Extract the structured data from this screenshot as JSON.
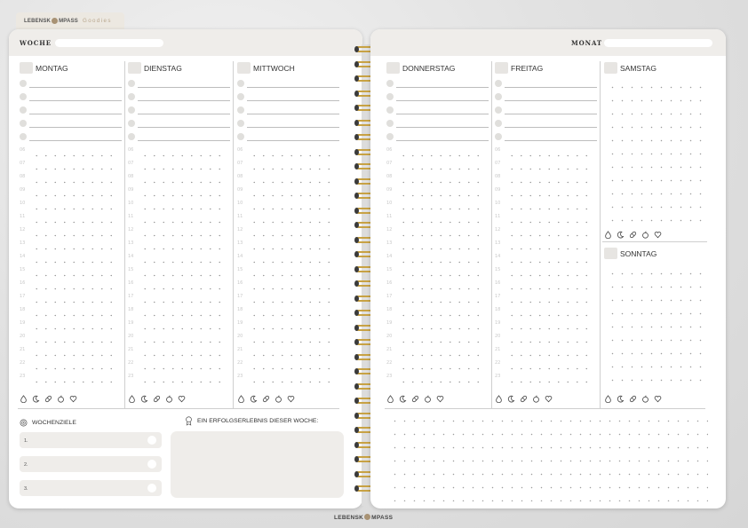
{
  "brand": {
    "part1": "LEBENSK",
    "part2": "MPASS",
    "goodies": "Goodies"
  },
  "left": {
    "week_label": "WOCHE"
  },
  "right": {
    "month_label": "MONAT"
  },
  "days": {
    "mon": "MONTAG",
    "tue": "DIENSTAG",
    "wed": "MITTWOCH",
    "thu": "DONNERSTAG",
    "fri": "FREITAG",
    "sat": "SAMSTAG",
    "sun": "SONNTAG"
  },
  "hours": [
    "06",
    "07",
    "08",
    "09",
    "10",
    "11",
    "12",
    "13",
    "14",
    "15",
    "16",
    "17",
    "18",
    "19",
    "20",
    "21",
    "22",
    "23"
  ],
  "tracker_icons": [
    "water-drop-icon",
    "moon-icon",
    "pill-icon",
    "apple-icon",
    "heart-icon"
  ],
  "goals": {
    "title": "WOCHENZIELE",
    "items": [
      "1.",
      "2.",
      "3."
    ]
  },
  "success": {
    "title": "EIN ERFOLGSERLEBNIS DIESER WOCHE:"
  },
  "footer": {
    "part1": "LEBENSK",
    "part2": "MPASS"
  },
  "colors": {
    "panel": "#efedea",
    "ring": "#c8a244",
    "accent": "#a89274"
  }
}
